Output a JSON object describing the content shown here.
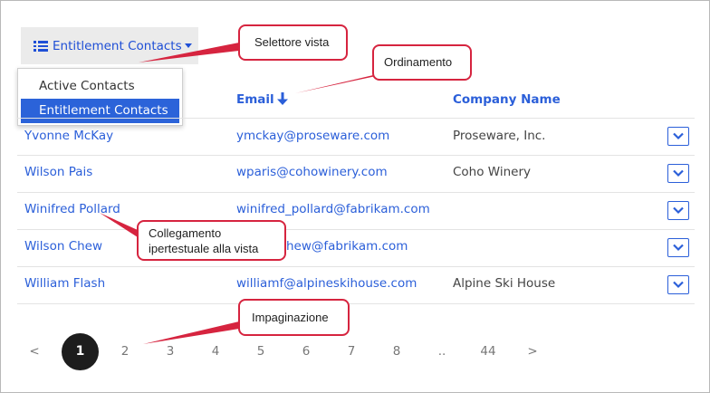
{
  "view_selector": {
    "label": "Entitlement Contacts",
    "options": [
      "Active Contacts",
      "Entitlement Contacts"
    ],
    "selected": "Entitlement Contacts"
  },
  "table": {
    "columns": [
      "Email",
      "Company Name"
    ],
    "sort": {
      "column": "Email",
      "direction": "descending"
    },
    "rows": [
      {
        "name": "Yvonne McKay",
        "email": "ymckay@proseware.com",
        "company": "Proseware, Inc."
      },
      {
        "name": "Wilson Pais",
        "email": "wparis@cohowinery.com",
        "company": "Coho Winery"
      },
      {
        "name": "Winifred Pollard",
        "email": "winifred_pollard@fabrikam.com",
        "company": ""
      },
      {
        "name": "Wilson Chew",
        "email": "hew@fabrikam.com",
        "company": ""
      },
      {
        "name": "William Flash",
        "email": "williamf@alpineskihouse.com",
        "company": "Alpine Ski House"
      }
    ]
  },
  "pagination": {
    "prev": "<",
    "current": "1",
    "pages": [
      "2",
      "3",
      "4",
      "5",
      "6",
      "7",
      "8",
      "..",
      "44"
    ],
    "next": ">"
  },
  "annotations": {
    "view_selector": "Selettore vista",
    "sorting": "Ordinamento",
    "hyperlink_line1": "Collegamento",
    "hyperlink_line2": "ipertestuale alla vista",
    "pagination": "Impaginazione"
  },
  "colors": {
    "link": "#2b5fd9",
    "selected_option_bg": "#2b63d9",
    "callout_border": "#d6243f",
    "active_page_bg": "#1d1d1d"
  }
}
